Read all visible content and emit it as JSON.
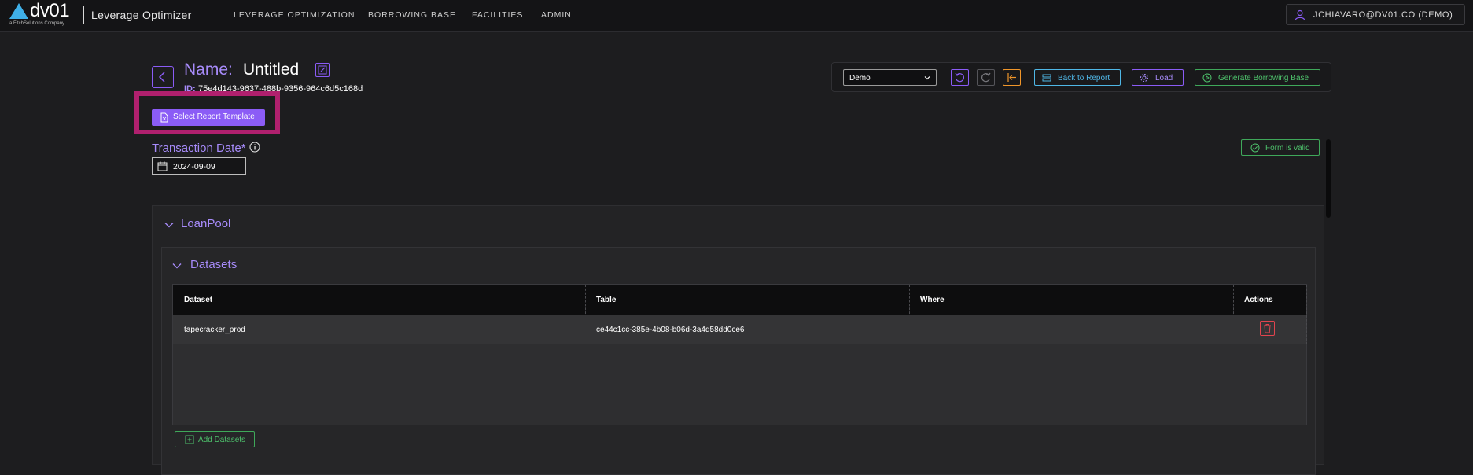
{
  "header": {
    "logo_text": "dv01",
    "logo_subtext": "a FitchSolutions Company",
    "app_title": "Leverage Optimizer",
    "nav": [
      "LEVERAGE OPTIMIZATION",
      "BORROWING BASE",
      "FACILITIES",
      "ADMIN"
    ],
    "user": "JCHIAVARO@DV01.CO (DEMO)"
  },
  "report": {
    "name_label": "Name:",
    "name_value": "Untitled",
    "id_label": "ID:",
    "id_value": "75e4d143-9637-488b-9356-964c6d5c168d",
    "select_template_label": "Select Report Template",
    "transaction_date_label": "Transaction Date*",
    "transaction_date_value": "2024-09-09",
    "form_status": "Form is valid"
  },
  "toolbar": {
    "selected_option": "Demo",
    "back_to_report": "Back to Report",
    "load": "Load",
    "generate": "Generate Borrowing Base"
  },
  "loanpool": {
    "title": "LoanPool",
    "datasets_title": "Datasets",
    "columns": [
      "Dataset",
      "Table",
      "Where",
      "Actions"
    ],
    "rows": [
      {
        "dataset": "tapecracker_prod",
        "table": "ce44c1cc-385e-4b08-b06d-3a4d58dd0ce6",
        "where": ""
      }
    ],
    "add_datasets": "Add Datasets"
  },
  "colors": {
    "accent_purple": "#8b5cf6",
    "label_purple": "#a78bfa",
    "highlight": "#b0206e",
    "success_green": "#4ec26c",
    "info_blue": "#4fb7e6",
    "warning_orange": "#f0962a",
    "danger_red": "#e0444e"
  }
}
